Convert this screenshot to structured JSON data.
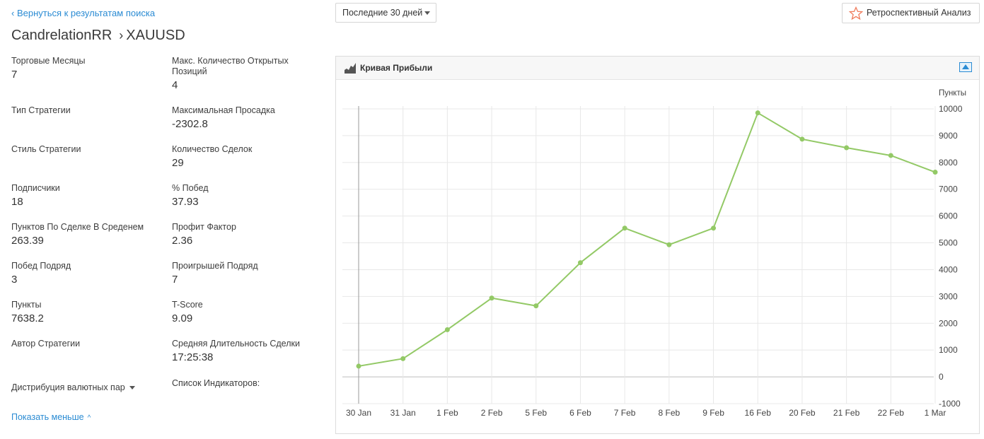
{
  "nav": {
    "back_label": "‹ Вернуться к результатам поиска"
  },
  "title": {
    "strategy": "CandrelationRR",
    "separator": "›",
    "symbol": "XAUUSD"
  },
  "stats_left": [
    {
      "label": "Торговые Месяцы",
      "value": "7"
    },
    {
      "label": "Тип Стратегии",
      "value": ""
    },
    {
      "label": "Стиль Стратегии",
      "value": ""
    },
    {
      "label": "Подписчики",
      "value": "18"
    },
    {
      "label": "Пунктов По Сделке В Среденем",
      "value": "263.39"
    },
    {
      "label": "Побед Подряд",
      "value": "3"
    },
    {
      "label": "Пункты",
      "value": "7638.2"
    },
    {
      "label": "Автор Стратегии",
      "value": ""
    }
  ],
  "stats_right": [
    {
      "label": "Макс. Количество Открытых Позиций",
      "value": "4"
    },
    {
      "label": "Максимальная Просадка",
      "value": "-2302.8"
    },
    {
      "label": "Количество Сделок",
      "value": "29"
    },
    {
      "label": "% Побед",
      "value": "37.93"
    },
    {
      "label": "Профит Фактор",
      "value": "2.36"
    },
    {
      "label": "Проигрышей Подряд",
      "value": "7"
    },
    {
      "label": "T-Score",
      "value": "9.09"
    },
    {
      "label": "Средняя Длительность Сделки",
      "value": "17:25:38"
    }
  ],
  "distribution": {
    "label": "Дистрибуция валютных пар"
  },
  "indicators": {
    "label": "Список Индикаторов:"
  },
  "show_less": {
    "label": "Показать меньше",
    "chevron": "^"
  },
  "period": {
    "selected": "Последние 30 дней"
  },
  "retro": {
    "label": "Ретроспективный Анализ"
  },
  "chart_panel": {
    "title": "Кривая Прибыли"
  },
  "colors": {
    "accent": "#2a8bd3",
    "series": "#93c966",
    "star": "#f07b5b"
  },
  "chart_data": {
    "type": "line",
    "title": "Кривая Прибыли",
    "ylabel": "Пункты",
    "xlabel": "",
    "categories": [
      "30 Jan",
      "31 Jan",
      "1 Feb",
      "2 Feb",
      "5 Feb",
      "6 Feb",
      "7 Feb",
      "8 Feb",
      "9 Feb",
      "16 Feb",
      "20 Feb",
      "21 Feb",
      "22 Feb",
      "1 Mar"
    ],
    "values": [
      400,
      680,
      1760,
      2940,
      2650,
      4260,
      5550,
      4930,
      5550,
      9850,
      8870,
      8550,
      8260,
      7638
    ],
    "ylim": [
      -1000,
      10000
    ],
    "yticks": [
      -1000,
      0,
      1000,
      2000,
      3000,
      4000,
      5000,
      6000,
      7000,
      8000,
      9000,
      10000
    ],
    "grid": true,
    "y_axis_side": "right",
    "legend": "none"
  }
}
